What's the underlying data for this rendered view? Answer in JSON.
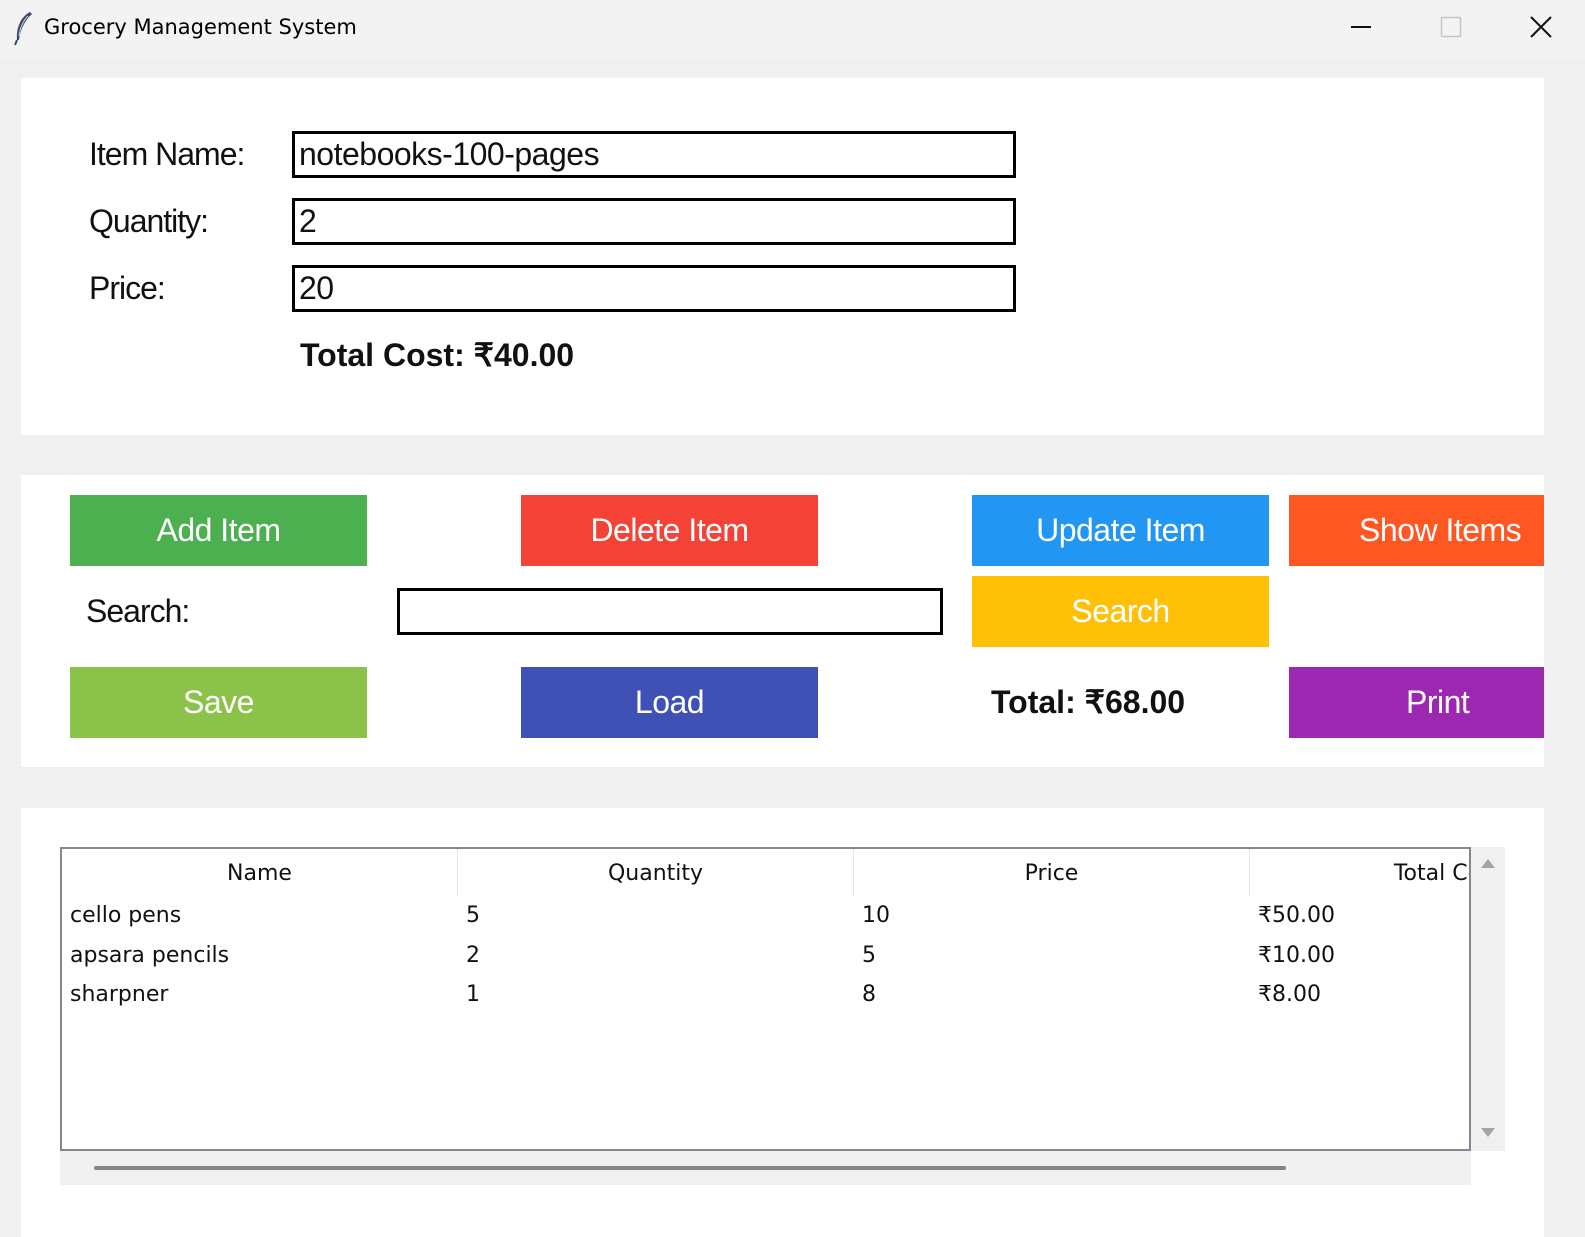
{
  "window": {
    "title": "Grocery Management System",
    "icon": "feather-icon",
    "controls": [
      "minimize-icon",
      "maximize-icon",
      "close-icon"
    ]
  },
  "form": {
    "item_name_label": "Item Name:",
    "item_name_value": "notebooks-100-pages",
    "quantity_label": "Quantity:",
    "quantity_value": "2",
    "price_label": "Price:",
    "price_value": "20",
    "total_cost": "Total Cost: ₹40.00"
  },
  "actions": {
    "add_label": "Add Item",
    "delete_label": "Delete Item",
    "update_label": "Update Item",
    "show_label": "Show Items",
    "search_label": "Search:",
    "search_value": "",
    "search_button_label": "Search",
    "save_label": "Save",
    "load_label": "Load",
    "grand_total": "Total: ₹68.00",
    "print_label": "Print"
  },
  "colors": {
    "add": "#4caf50",
    "delete": "#f44336",
    "update": "#2196f3",
    "show": "#ff5722",
    "search": "#ffc107",
    "save": "#8bc34a",
    "load": "#3f51b5",
    "print": "#9c27b0"
  },
  "table": {
    "columns": [
      "Name",
      "Quantity",
      "Price",
      "Total Cost"
    ],
    "rows": [
      [
        "cello pens",
        "5",
        "10",
        "₹50.00"
      ],
      [
        "apsara pencils",
        "2",
        "5",
        "₹10.00"
      ],
      [
        "sharpner",
        "1",
        "8",
        "₹8.00"
      ]
    ]
  }
}
